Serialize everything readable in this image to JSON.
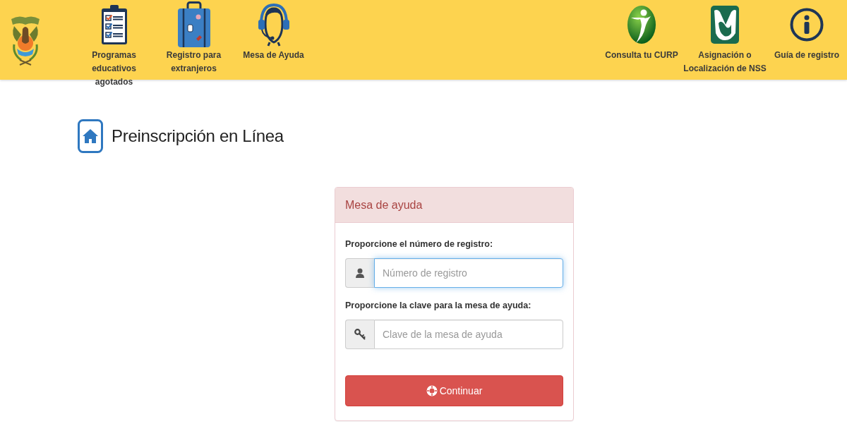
{
  "header": {
    "nav_left": [
      {
        "label": "Programas educativos agotados"
      },
      {
        "label": "Registro para extranjeros"
      },
      {
        "label": "Mesa de Ayuda"
      }
    ],
    "nav_right": [
      {
        "label": "Consulta tu CURP"
      },
      {
        "label": "Asignación o Localización de NSS"
      },
      {
        "label": "Guía de registro"
      }
    ]
  },
  "page_title": "Preinscripción en Línea",
  "panel": {
    "heading": "Mesa de ayuda",
    "fields": [
      {
        "label": "Proporcione el número de registro:",
        "placeholder": "Número de registro",
        "focused": true
      },
      {
        "label": "Proporcione la clave para la mesa de ayuda:",
        "placeholder": "Clave de la mesa de ayuda",
        "focused": false
      }
    ],
    "submit_button": "Continuar"
  }
}
